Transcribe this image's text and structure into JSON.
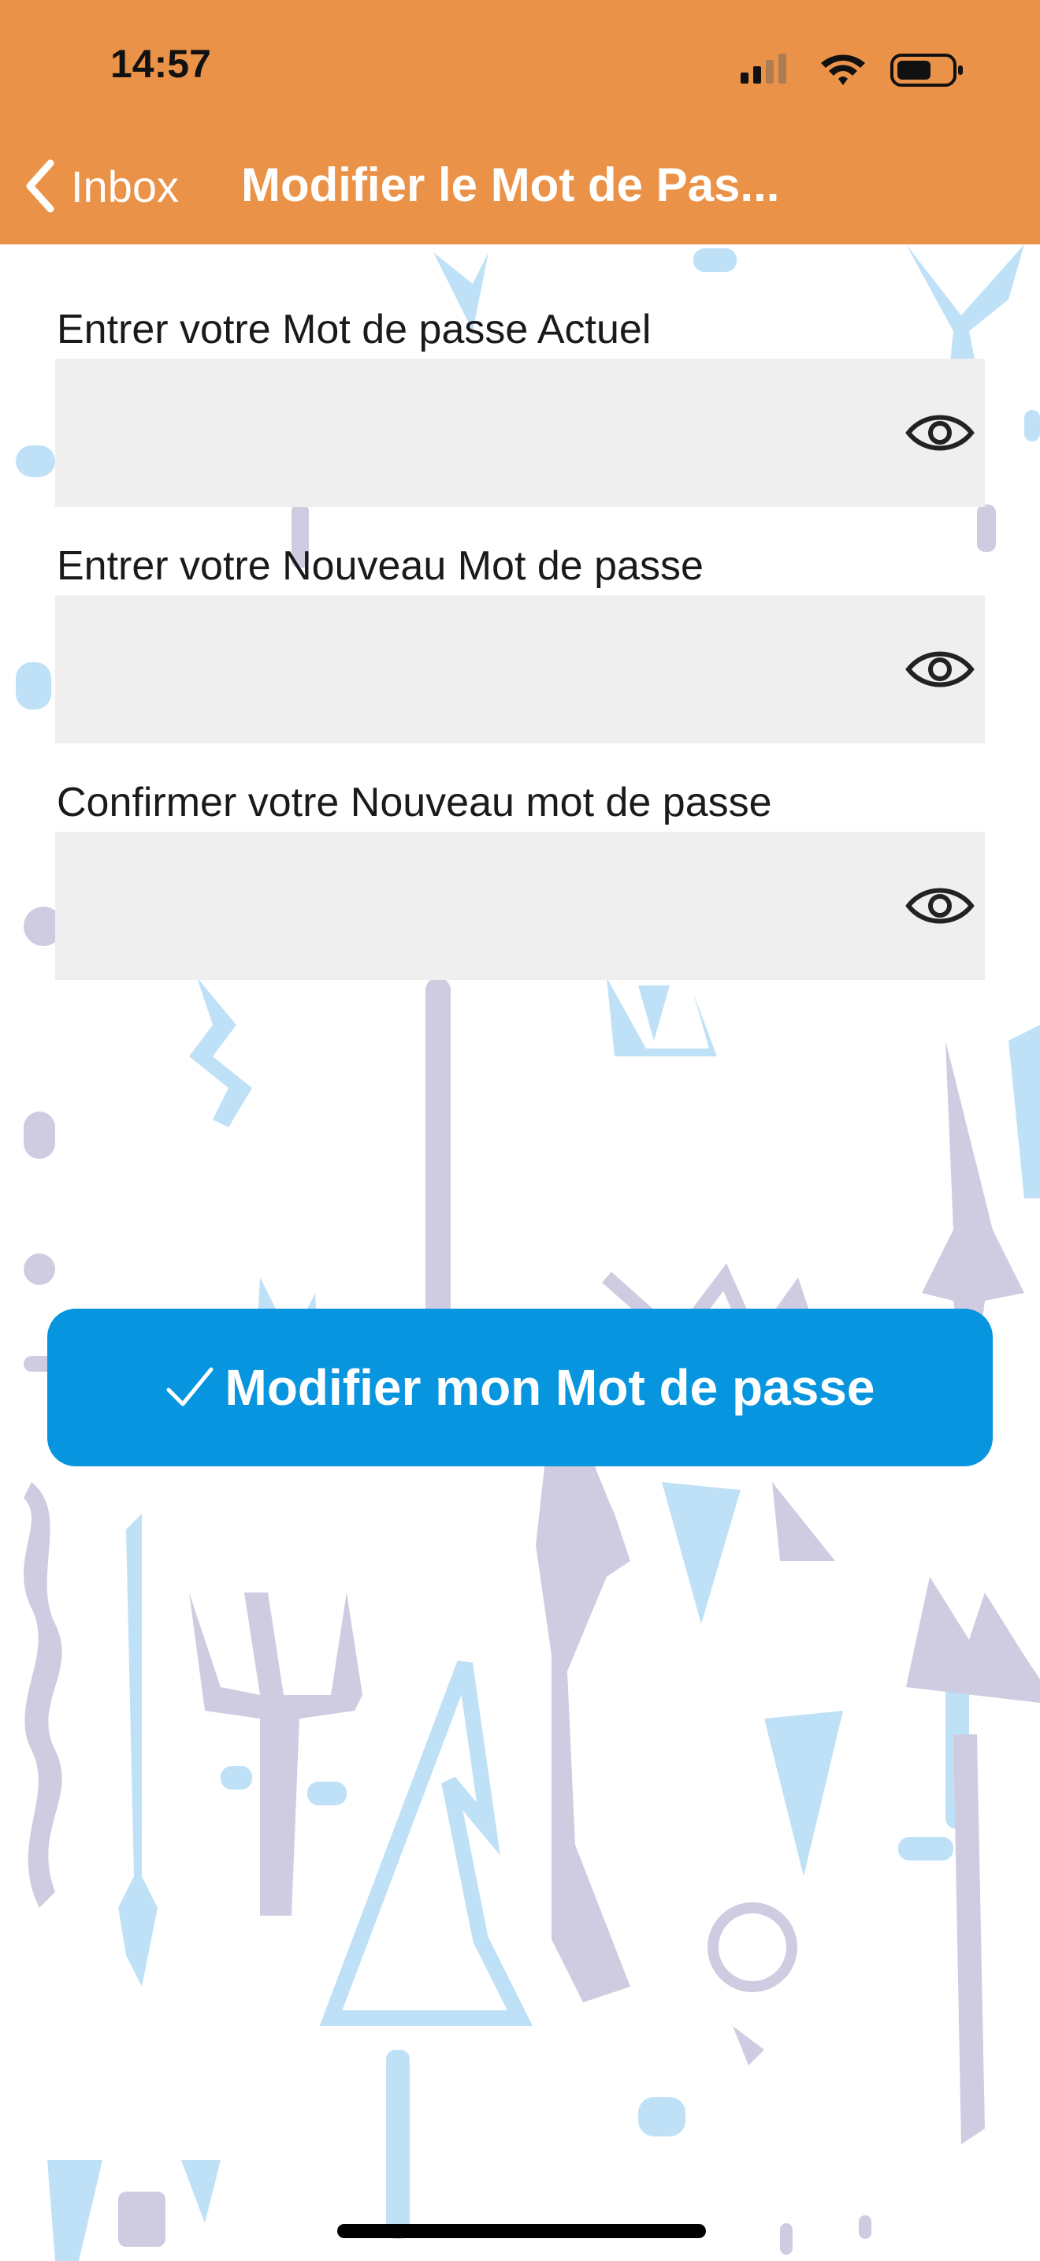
{
  "status_bar": {
    "time": "14:57"
  },
  "nav": {
    "back_label": "Inbox",
    "title": "Modifier le Mot de Pas..."
  },
  "form": {
    "current_password_label": "Entrer votre Mot de passe Actuel",
    "new_password_label": "Entrer votre Nouveau Mot de passe",
    "confirm_password_label": "Confirmer votre Nouveau mot de passe",
    "submit_label": "Modifier mon Mot de passe"
  },
  "colors": {
    "header": "#EB9249",
    "button": "#0795DF",
    "input_bg": "#EFEFEF",
    "pattern_blue": "#BFE1F7",
    "pattern_lavender": "#CFCCE2"
  }
}
